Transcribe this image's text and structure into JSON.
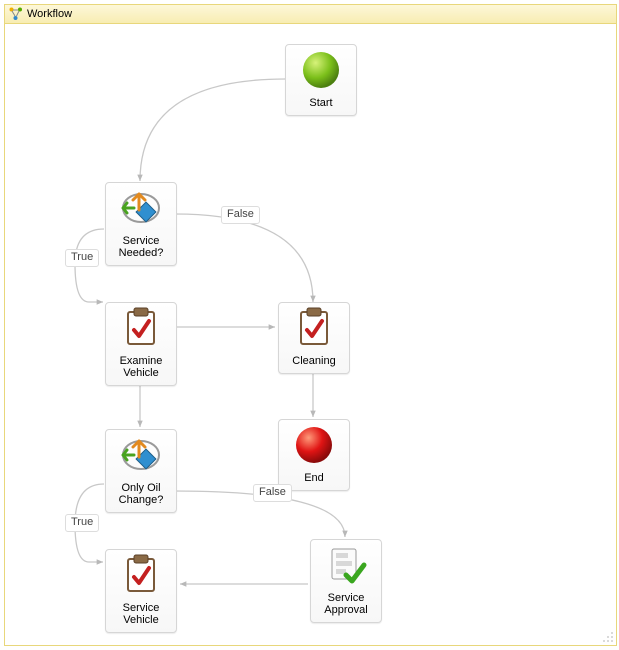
{
  "panel": {
    "title": "Workflow"
  },
  "nodes": {
    "start": {
      "label": "Start"
    },
    "service_needed": {
      "label": "Service Needed?"
    },
    "examine": {
      "label": "Examine Vehicle"
    },
    "cleaning": {
      "label": "Cleaning"
    },
    "end": {
      "label": "End"
    },
    "oil_change": {
      "label": "Only Oil Change?"
    },
    "service_vehicle": {
      "label": "Service Vehicle"
    },
    "service_approval": {
      "label": "Service Approval"
    }
  },
  "edges": {
    "sn_false": "False",
    "sn_true": "True",
    "oc_false": "False",
    "oc_true": "True"
  }
}
